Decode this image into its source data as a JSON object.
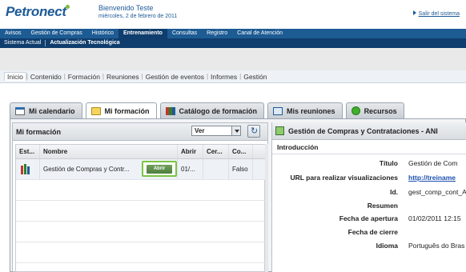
{
  "header": {
    "logo": "Petronect",
    "welcome": "Bienvenido",
    "user": "Teste",
    "date": "miércoles, 2 de febrero de 2011",
    "logout": "Salir del sistema"
  },
  "nav_primary": [
    "Avisos",
    "Gestión de Compras",
    "Histórico",
    "Entrenamiento",
    "Consultas",
    "Registro",
    "Canal de Atención"
  ],
  "nav_primary_active": "Entrenamiento",
  "nav_secondary": [
    "Sistema Actual",
    "Actualización Tecnológica"
  ],
  "subnav": [
    "Inicio",
    "Contenido",
    "Formación",
    "Reuniones",
    "Gestión de eventos",
    "Informes",
    "Gestión"
  ],
  "tabs": [
    {
      "label": "Mi calendario",
      "icon": "calendar-icon"
    },
    {
      "label": "Mi formación",
      "icon": "folder-icon"
    },
    {
      "label": "Catálogo de formación",
      "icon": "books-icon"
    },
    {
      "label": "Mis reuniones",
      "icon": "meeting-icon"
    },
    {
      "label": "Recursos",
      "icon": "resources-icon"
    }
  ],
  "left_panel": {
    "title": "Mi formación",
    "view_select": "Ver",
    "columns": [
      "Est...",
      "Nombre",
      "Abrir",
      "Cer...",
      "Co..."
    ],
    "rows": [
      {
        "name": "Gestión de Compras y Contr...",
        "action": "Abrir",
        "abrir": "01/...",
        "cerrar": "",
        "completo": "Falso"
      }
    ]
  },
  "right_panel": {
    "title": "Gestión de Compras y Contrataciones - ANI",
    "section": "Introducción",
    "fields": [
      {
        "label": "Título",
        "value": "Gestión de Com"
      },
      {
        "label": "URL para realizar visualizaciones",
        "value": "http://treiname"
      },
      {
        "label": "Id.",
        "value": "gest_comp_cont_A"
      },
      {
        "label": "Resumen",
        "value": ""
      },
      {
        "label": "Fecha de apertura",
        "value": "01/02/2011 12:15"
      },
      {
        "label": "Fecha de cierre",
        "value": ""
      },
      {
        "label": "Idioma",
        "value": "Português do Bras"
      }
    ]
  },
  "colors": {
    "nav_blue": "#1d5b93",
    "nav_dark": "#0f3d6d",
    "accent_green": "#7cc442"
  }
}
